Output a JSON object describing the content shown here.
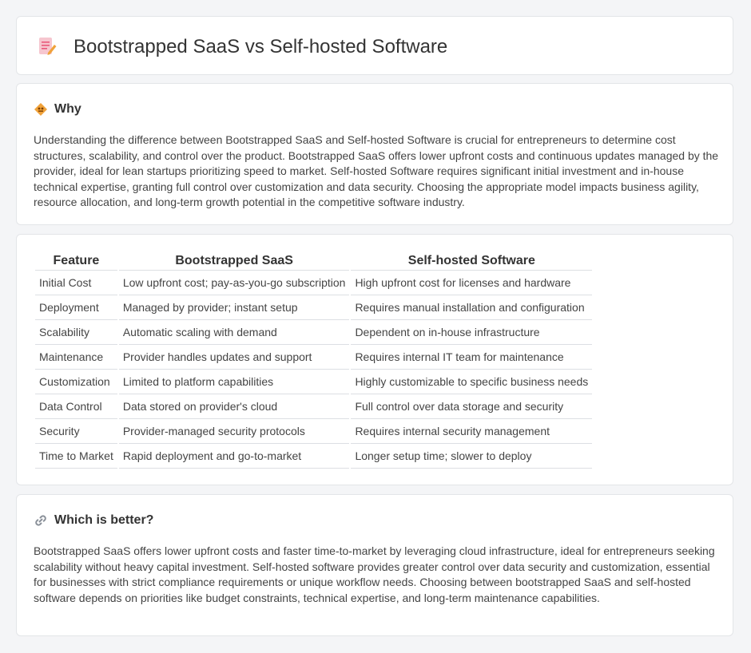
{
  "header": {
    "title": "Bootstrapped SaaS vs Self-hosted Software",
    "icon": "document-pencil-icon"
  },
  "why": {
    "title": "Why",
    "icon": "diamond-sign-icon",
    "text": "Understanding the difference between Bootstrapped SaaS and Self-hosted Software is crucial for entrepreneurs to determine cost structures, scalability, and control over the product. Bootstrapped SaaS offers lower upfront costs and continuous updates managed by the provider, ideal for lean startups prioritizing speed to market. Self-hosted Software requires significant initial investment and in-house technical expertise, granting full control over customization and data security. Choosing the appropriate model impacts business agility, resource allocation, and long-term growth potential in the competitive software industry."
  },
  "table": {
    "headers": [
      "Feature",
      "Bootstrapped SaaS",
      "Self-hosted Software"
    ],
    "rows": [
      [
        "Initial Cost",
        "Low upfront cost; pay-as-you-go subscription",
        "High upfront cost for licenses and hardware"
      ],
      [
        "Deployment",
        "Managed by provider; instant setup",
        "Requires manual installation and configuration"
      ],
      [
        "Scalability",
        "Automatic scaling with demand",
        "Dependent on in-house infrastructure"
      ],
      [
        "Maintenance",
        "Provider handles updates and support",
        "Requires internal IT team for maintenance"
      ],
      [
        "Customization",
        "Limited to platform capabilities",
        "Highly customizable to specific business needs"
      ],
      [
        "Data Control",
        "Data stored on provider's cloud",
        "Full control over data storage and security"
      ],
      [
        "Security",
        "Provider-managed security protocols",
        "Requires internal security management"
      ],
      [
        "Time to Market",
        "Rapid deployment and go-to-market",
        "Longer setup time; slower to deploy"
      ]
    ]
  },
  "better": {
    "title": "Which is better?",
    "icon": "link-icon",
    "text": "Bootstrapped SaaS offers lower upfront costs and faster time-to-market by leveraging cloud infrastructure, ideal for entrepreneurs seeking scalability without heavy capital investment. Self-hosted software provides greater control over data security and customization, essential for businesses with strict compliance requirements or unique workflow needs. Choosing between bootstrapped SaaS and self-hosted software depends on priorities like budget constraints, technical expertise, and long-term maintenance capabilities."
  },
  "colors": {
    "background": "#f4f5f7",
    "card": "#ffffff",
    "border": "#e3e5e8",
    "icon_orange": "#f0a23a",
    "icon_pink": "#e9577a"
  }
}
